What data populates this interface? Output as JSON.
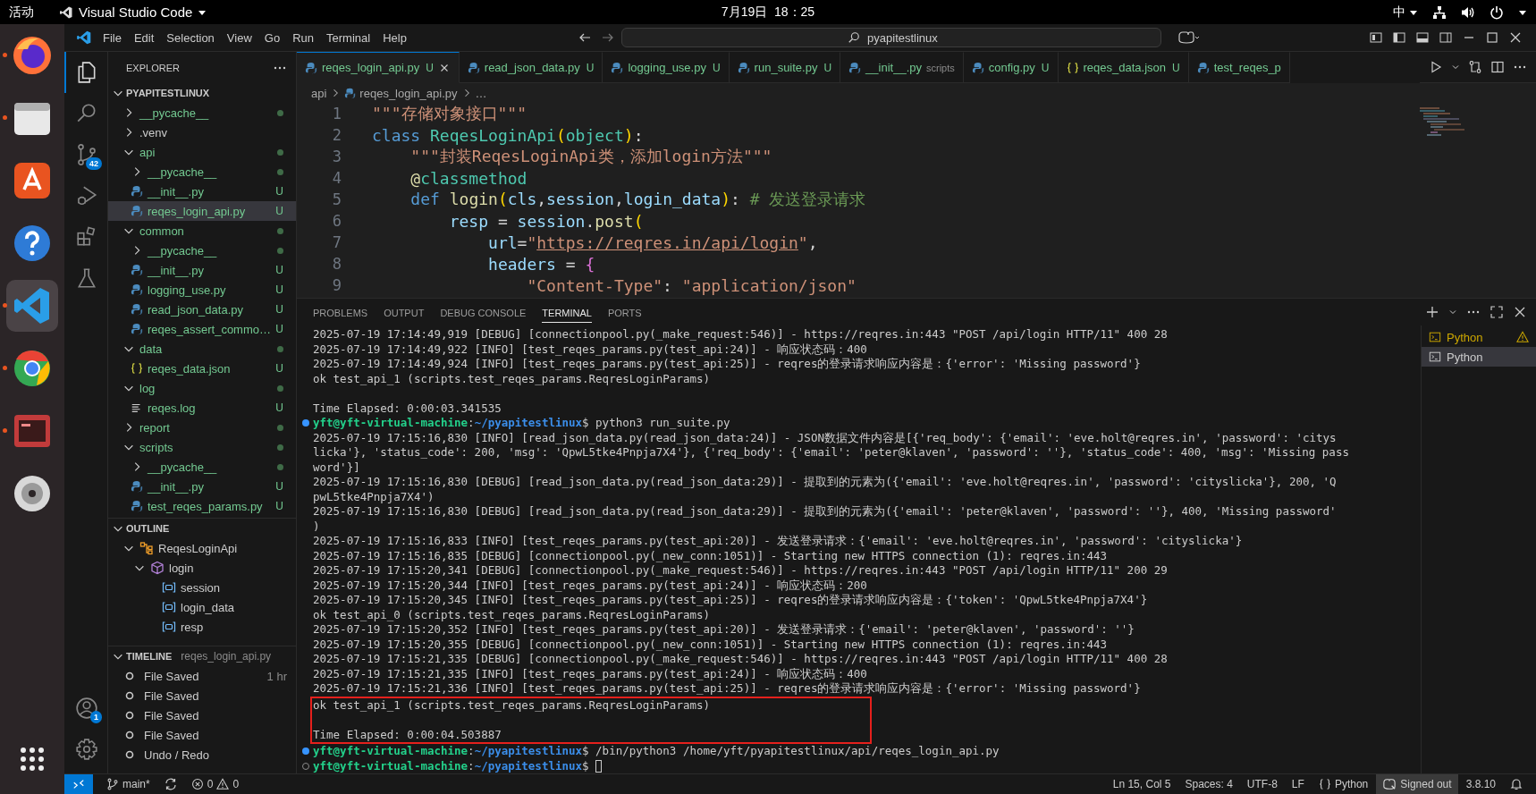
{
  "topbar": {
    "activities": "活动",
    "app_name": "Visual Studio Code",
    "clock": "7月19日  18：25",
    "input_method": "中"
  },
  "dock": [
    {
      "kind": "firefox",
      "running": true,
      "selected": false
    },
    {
      "kind": "files",
      "running": true,
      "selected": false
    },
    {
      "kind": "store",
      "running": false,
      "selected": false
    },
    {
      "kind": "help",
      "running": false,
      "selected": false
    },
    {
      "kind": "code",
      "running": true,
      "selected": true
    },
    {
      "kind": "chrome",
      "running": true,
      "selected": false
    },
    {
      "kind": "redapp",
      "running": true,
      "selected": false
    },
    {
      "kind": "disc",
      "running": false,
      "selected": false
    }
  ],
  "titlebar": {
    "menu": [
      "File",
      "Edit",
      "Selection",
      "View",
      "Go",
      "Run",
      "Terminal",
      "Help"
    ],
    "search": "pyapitestlinux"
  },
  "activity_bar": {
    "items": [
      {
        "kind": "explorer",
        "selected": true
      },
      {
        "kind": "search",
        "selected": false
      },
      {
        "kind": "source-control",
        "badge": "42",
        "selected": false
      },
      {
        "kind": "run",
        "selected": false
      },
      {
        "kind": "extensions",
        "selected": false
      },
      {
        "kind": "testing",
        "selected": false
      }
    ],
    "bottom": [
      {
        "kind": "accounts",
        "badge": "1"
      },
      {
        "kind": "settings"
      }
    ]
  },
  "explorer": {
    "title": "EXPLORER",
    "root": {
      "label": "PYAPITESTLINUX",
      "expanded": true,
      "children": [
        {
          "label": "__pycache__",
          "kind": "folder",
          "expanded": false,
          "selected": false,
          "untracked": true,
          "dot": true
        },
        {
          "label": ".venv",
          "kind": "folder",
          "expanded": false,
          "selected": false,
          "untracked": false,
          "dot": false
        },
        {
          "label": "api",
          "kind": "folder",
          "expanded": true,
          "selected": false,
          "untracked": true,
          "dot": true,
          "children": [
            {
              "label": "__pycache__",
              "kind": "folder",
              "expanded": false,
              "selected": false,
              "untracked": true,
              "dot": true
            },
            {
              "label": "__init__.py",
              "kind": "python",
              "selected": false,
              "untracked": true,
              "badge": "U",
              "dot": false
            },
            {
              "label": "reqes_login_api.py",
              "kind": "python",
              "selected": true,
              "untracked": true,
              "badge": "U",
              "dot": false
            }
          ]
        },
        {
          "label": "common",
          "kind": "folder",
          "expanded": true,
          "selected": false,
          "untracked": true,
          "dot": true,
          "children": [
            {
              "label": "__pycache__",
              "kind": "folder",
              "expanded": false,
              "selected": false,
              "untracked": true,
              "dot": true
            },
            {
              "label": "__init__.py",
              "kind": "python",
              "selected": false,
              "untracked": true,
              "badge": "U",
              "dot": false
            },
            {
              "label": "logging_use.py",
              "kind": "python",
              "selected": false,
              "untracked": true,
              "badge": "U",
              "dot": false
            },
            {
              "label": "read_json_data.py",
              "kind": "python",
              "selected": false,
              "untracked": true,
              "badge": "U",
              "dot": false
            },
            {
              "label": "reqes_assert_commo…",
              "kind": "python",
              "selected": false,
              "untracked": true,
              "badge": "U",
              "dot": false
            }
          ]
        },
        {
          "label": "data",
          "kind": "folder",
          "expanded": true,
          "selected": false,
          "untracked": true,
          "dot": true,
          "children": [
            {
              "label": "reqes_data.json",
              "kind": "json",
              "selected": false,
              "untracked": true,
              "badge": "U",
              "dot": false
            }
          ]
        },
        {
          "label": "log",
          "kind": "folder",
          "expanded": true,
          "selected": false,
          "untracked": true,
          "dot": true,
          "children": [
            {
              "label": "reqes.log",
              "kind": "log",
              "selected": false,
              "untracked": true,
              "badge": "U",
              "dot": false
            }
          ]
        },
        {
          "label": "report",
          "kind": "folder",
          "expanded": false,
          "selected": false,
          "untracked": true,
          "dot": true
        },
        {
          "label": "scripts",
          "kind": "folder",
          "expanded": true,
          "selected": false,
          "untracked": true,
          "dot": true,
          "children": [
            {
              "label": "__pycache__",
              "kind": "folder",
              "expanded": false,
              "selected": false,
              "untracked": true,
              "dot": true
            },
            {
              "label": "__init__.py",
              "kind": "python",
              "selected": false,
              "untracked": true,
              "badge": "U",
              "dot": false
            },
            {
              "label": "test_reqes_params.py",
              "kind": "python",
              "selected": false,
              "untracked": true,
              "badge": "U",
              "dot": false
            }
          ]
        }
      ]
    }
  },
  "outline": {
    "title": "OUTLINE",
    "items": [
      {
        "label": "ReqesLoginApi",
        "kind": "class",
        "expanded": true,
        "children": [
          {
            "label": "login",
            "kind": "method",
            "expanded": true,
            "children": [
              {
                "label": "session",
                "kind": "variable"
              },
              {
                "label": "login_data",
                "kind": "variable"
              },
              {
                "label": "resp",
                "kind": "variable"
              }
            ]
          }
        ]
      }
    ]
  },
  "timeline": {
    "title": "TIMELINE",
    "file": "reqes_login_api.py",
    "items": [
      {
        "label": "File Saved",
        "time": "1 hr"
      },
      {
        "label": "File Saved"
      },
      {
        "label": "File Saved"
      },
      {
        "label": "File Saved"
      },
      {
        "label": "Undo / Redo"
      }
    ]
  },
  "tabs": [
    {
      "label": "reqes_login_api.py",
      "kind": "python",
      "badge": "U",
      "selected": true
    },
    {
      "label": "read_json_data.py",
      "kind": "python",
      "badge": "U",
      "selected": false
    },
    {
      "label": "logging_use.py",
      "kind": "python",
      "badge": "U",
      "selected": false
    },
    {
      "label": "run_suite.py",
      "kind": "python",
      "badge": "U",
      "selected": false
    },
    {
      "label": "__init__.py",
      "kind": "python",
      "description": "scripts",
      "selected": false
    },
    {
      "label": "config.py",
      "kind": "python",
      "badge": "U",
      "selected": false
    },
    {
      "label": "reqes_data.json",
      "kind": "json",
      "badge": "U",
      "selected": false
    },
    {
      "label": "test_reqes_p",
      "kind": "python",
      "selected": false
    }
  ],
  "breadcrumb": [
    "api",
    "reqes_login_api.py",
    "…"
  ],
  "editor": {
    "lines": [
      {
        "number": "1",
        "tokens": [
          {
            "kind": "string",
            "text": "\"\"\"存储对象接口\"\"\""
          }
        ]
      },
      {
        "number": "2",
        "tokens": [
          {
            "kind": "keyword",
            "text": "class "
          },
          {
            "kind": "class",
            "text": "ReqesLoginApi"
          },
          {
            "kind": "paren1",
            "text": "("
          },
          {
            "kind": "class",
            "text": "object"
          },
          {
            "kind": "paren1",
            "text": ")"
          },
          {
            "kind": "punct",
            "text": ":"
          }
        ]
      },
      {
        "number": "3",
        "tokens": [
          {
            "kind": "string",
            "text": "    \"\"\"封装ReqesLoginApi类，添加login方法\"\"\""
          }
        ]
      },
      {
        "number": "4",
        "tokens": [
          {
            "kind": "decorator",
            "text": "    @"
          },
          {
            "kind": "class",
            "text": "classmethod"
          }
        ]
      },
      {
        "number": "5",
        "tokens": [
          {
            "kind": "keyword",
            "text": "    def "
          },
          {
            "kind": "func",
            "text": "login"
          },
          {
            "kind": "paren1",
            "text": "("
          },
          {
            "kind": "param",
            "text": "cls"
          },
          {
            "kind": "punct",
            "text": ","
          },
          {
            "kind": "param",
            "text": "session"
          },
          {
            "kind": "punct",
            "text": ","
          },
          {
            "kind": "param",
            "text": "login_data"
          },
          {
            "kind": "paren1",
            "text": ")"
          },
          {
            "kind": "punct",
            "text": ": "
          },
          {
            "kind": "comment",
            "text": "# 发送登录请求"
          }
        ]
      },
      {
        "number": "6",
        "tokens": [
          {
            "kind": "param",
            "text": "        resp"
          },
          {
            "kind": "punct",
            "text": " = "
          },
          {
            "kind": "param",
            "text": "session"
          },
          {
            "kind": "punct",
            "text": "."
          },
          {
            "kind": "func",
            "text": "post"
          },
          {
            "kind": "paren1",
            "text": "("
          }
        ]
      },
      {
        "number": "7",
        "tokens": [
          {
            "kind": "param",
            "text": "            url"
          },
          {
            "kind": "punct",
            "text": "="
          },
          {
            "kind": "string",
            "text": "\""
          },
          {
            "kind": "url",
            "text": "https://reqres.in/api/login"
          },
          {
            "kind": "string",
            "text": "\""
          },
          {
            "kind": "punct",
            "text": ","
          }
        ]
      },
      {
        "number": "8",
        "tokens": [
          {
            "kind": "param",
            "text": "            headers"
          },
          {
            "kind": "punct",
            "text": " = "
          },
          {
            "kind": "paren2",
            "text": "{"
          }
        ]
      },
      {
        "number": "9",
        "tokens": [
          {
            "kind": "string",
            "text": "                \"Content-Type\""
          },
          {
            "kind": "punct",
            "text": ": "
          },
          {
            "kind": "string",
            "text": "\"application/json\""
          }
        ]
      }
    ]
  },
  "panel": {
    "tabs": [
      {
        "label": "PROBLEMS",
        "selected": false
      },
      {
        "label": "OUTPUT",
        "selected": false
      },
      {
        "label": "DEBUG CONSOLE",
        "selected": false
      },
      {
        "label": "TERMINAL",
        "selected": true
      },
      {
        "label": "PORTS",
        "selected": false
      }
    ],
    "terminals": [
      {
        "label": "Python",
        "warning": true,
        "selected": false
      },
      {
        "label": "Python",
        "warning": false,
        "selected": true
      }
    ],
    "lines": [
      {
        "kind": "log",
        "text": "2025-07-19 17:14:49,919 [DEBUG] [connectionpool.py(_make_request:546)] - https://reqres.in:443 \"POST /api/login HTTP/11\" 400 28"
      },
      {
        "kind": "log",
        "text": "2025-07-19 17:14:49,922 [INFO] [test_reqes_params.py(test_api:24)] - 响应状态码：400"
      },
      {
        "kind": "log",
        "text": "2025-07-19 17:14:49,924 [INFO] [test_reqes_params.py(test_api:25)] - reqres的登录请求响应内容是：{'error': 'Missing password'}"
      },
      {
        "kind": "log",
        "text": "ok test_api_1 (scripts.test_reqes_params.ReqresLoginParams)"
      },
      {
        "kind": "blank"
      },
      {
        "kind": "log",
        "text": "Time Elapsed: 0:00:03.341535"
      },
      {
        "kind": "prompt",
        "user": "yft@yft-virtual-machine",
        "separator": ":",
        "path": "~/pyapitestlinux",
        "symbol": "$",
        "command": "python3 run_suite.py",
        "cursor": false
      },
      {
        "kind": "log",
        "text": "2025-07-19 17:15:16,830 [INFO] [read_json_data.py(read_json_data:24)] - JSON数据文件内容是[{'req_body': {'email': 'eve.holt@reqres.in', 'password': 'citys"
      },
      {
        "kind": "log",
        "text": "licka'}, 'status_code': 200, 'msg': 'QpwL5tke4Pnpja7X4'}, {'req_body': {'email': 'peter@klaven', 'password': ''}, 'status_code': 400, 'msg': 'Missing pass"
      },
      {
        "kind": "log",
        "text": "word'}]"
      },
      {
        "kind": "log",
        "text": "2025-07-19 17:15:16,830 [DEBUG] [read_json_data.py(read_json_data:29)] - 提取到的元素为({'email': 'eve.holt@reqres.in', 'password': 'cityslicka'}, 200, 'Q"
      },
      {
        "kind": "log",
        "text": "pwL5tke4Pnpja7X4')"
      },
      {
        "kind": "log",
        "text": "2025-07-19 17:15:16,830 [DEBUG] [read_json_data.py(read_json_data:29)] - 提取到的元素为({'email': 'peter@klaven', 'password': ''}, 400, 'Missing password'"
      },
      {
        "kind": "log",
        "text": ")"
      },
      {
        "kind": "log",
        "text": "2025-07-19 17:15:16,833 [INFO] [test_reqes_params.py(test_api:20)] - 发送登录请求：{'email': 'eve.holt@reqres.in', 'password': 'cityslicka'}"
      },
      {
        "kind": "log",
        "text": "2025-07-19 17:15:16,835 [DEBUG] [connectionpool.py(_new_conn:1051)] - Starting new HTTPS connection (1): reqres.in:443"
      },
      {
        "kind": "log",
        "text": "2025-07-19 17:15:20,341 [DEBUG] [connectionpool.py(_make_request:546)] - https://reqres.in:443 \"POST /api/login HTTP/11\" 200 29"
      },
      {
        "kind": "log",
        "text": "2025-07-19 17:15:20,344 [INFO] [test_reqes_params.py(test_api:24)] - 响应状态码：200"
      },
      {
        "kind": "log",
        "text": "2025-07-19 17:15:20,345 [INFO] [test_reqes_params.py(test_api:25)] - reqres的登录请求响应内容是：{'token': 'QpwL5tke4Pnpja7X4'}"
      },
      {
        "kind": "log",
        "text": "ok test_api_0 (scripts.test_reqes_params.ReqresLoginParams)"
      },
      {
        "kind": "log",
        "text": "2025-07-19 17:15:20,352 [INFO] [test_reqes_params.py(test_api:20)] - 发送登录请求：{'email': 'peter@klaven', 'password': ''}"
      },
      {
        "kind": "log",
        "text": "2025-07-19 17:15:20,355 [DEBUG] [connectionpool.py(_new_conn:1051)] - Starting new HTTPS connection (1): reqres.in:443"
      },
      {
        "kind": "log",
        "text": "2025-07-19 17:15:21,335 [DEBUG] [connectionpool.py(_make_request:546)] - https://reqres.in:443 \"POST /api/login HTTP/11\" 400 28"
      },
      {
        "kind": "log",
        "text": "2025-07-19 17:15:21,335 [INFO] [test_reqes_params.py(test_api:24)] - 响应状态码：400"
      },
      {
        "kind": "log",
        "text": "2025-07-19 17:15:21,336 [INFO] [test_reqes_params.py(test_api:25)] - reqres的登录请求响应内容是：{'error': 'Missing password'}"
      },
      {
        "kind": "marked",
        "lines": [
          {
            "kind": "log",
            "text": "ok test_api_1 (scripts.test_reqes_params.ReqresLoginParams)"
          },
          {
            "kind": "blank"
          },
          {
            "kind": "log",
            "text": "Time Elapsed: 0:00:04.503887"
          }
        ]
      },
      {
        "kind": "prompt",
        "user": "yft@yft-virtual-machine",
        "separator": ":",
        "path": "~/pyapitestlinux",
        "symbol": "$",
        "command": "/bin/python3 /home/yft/pyapitestlinux/api/reqes_login_api.py",
        "cursor": false
      },
      {
        "kind": "prompt",
        "user": "yft@yft-virtual-machine",
        "separator": ":",
        "path": "~/pyapitestlinux",
        "symbol": "$",
        "cursor": true
      }
    ]
  },
  "status_bar": {
    "branch": "main*",
    "errors": "0",
    "warnings": "0",
    "items": [
      {
        "kind": "text",
        "label": "Ln 15, Col 5"
      },
      {
        "kind": "text",
        "label": "Spaces: 4"
      },
      {
        "kind": "text",
        "label": "UTF-8"
      },
      {
        "kind": "text",
        "label": "LF"
      },
      {
        "kind": "language",
        "label": "Python"
      },
      {
        "kind": "account",
        "label": "Signed out"
      },
      {
        "kind": "text",
        "label": "3.8.10"
      },
      {
        "kind": "notifications"
      }
    ]
  }
}
